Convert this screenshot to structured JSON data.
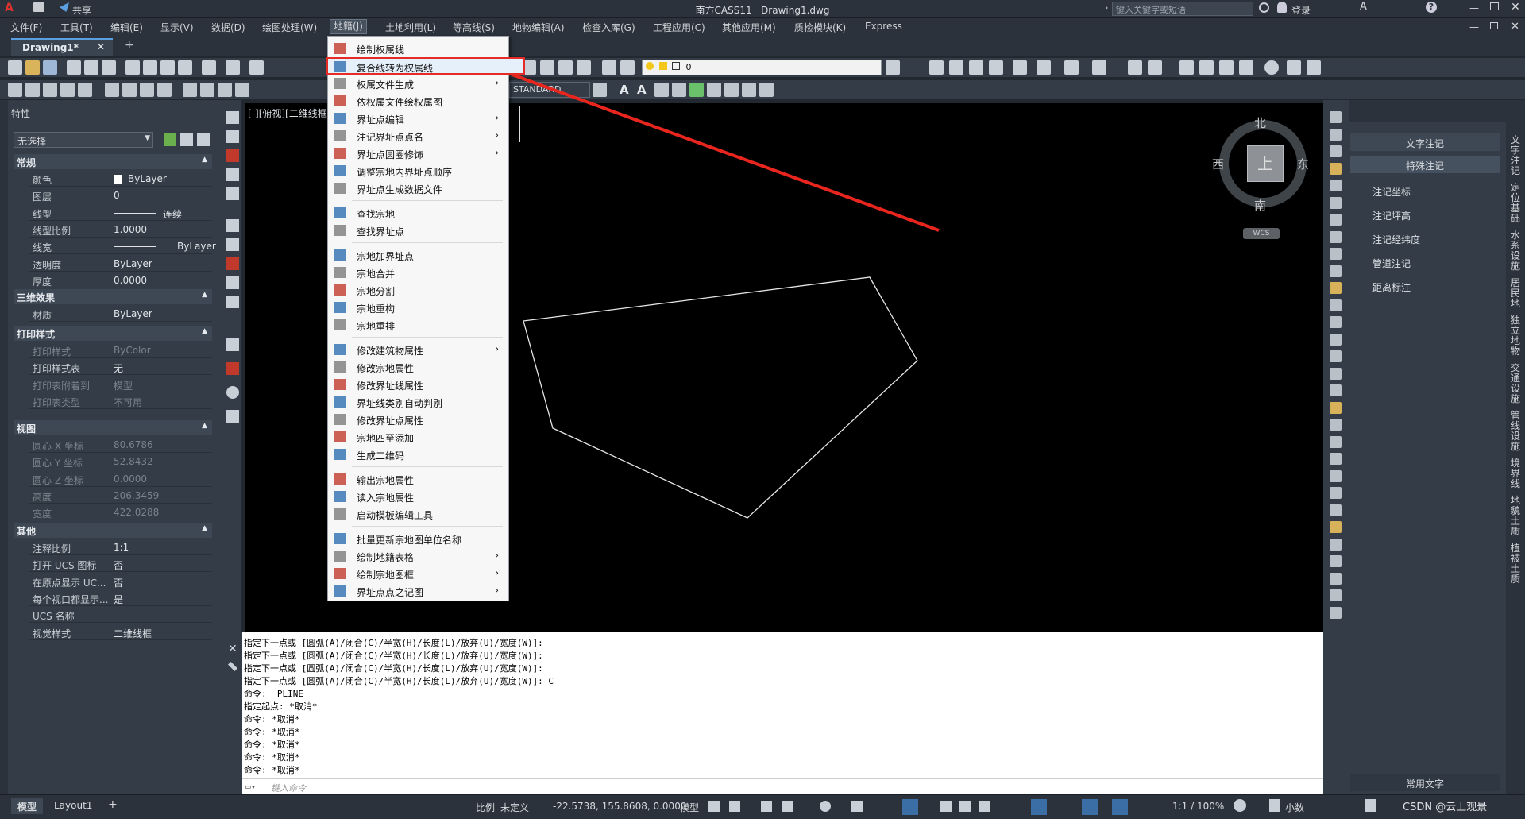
{
  "app": {
    "title": "南方CASS11",
    "filename": "Drawing1.dwg",
    "share_label": "共享",
    "search_placeholder": "键入关键字或短语",
    "login_label": "登录",
    "a_label": "A",
    "tab_label": "Drawing1*",
    "tab_plus": "+"
  },
  "menubar": {
    "items": [
      "文件(F)",
      "工具(T)",
      "编辑(E)",
      "显示(V)",
      "数据(D)",
      "绘图处理(W)",
      "地籍(J)",
      "土地利用(L)",
      "等高线(S)",
      "地物编辑(A)",
      "检查入库(G)",
      "工程应用(C)",
      "其他应用(M)",
      "质检模块(K)",
      "Express"
    ]
  },
  "toolbar": {
    "layer_value": "0",
    "style_value": "STANDARD"
  },
  "properties": {
    "title": "特性",
    "selection": "无选择",
    "sections": {
      "general": "常规",
      "effects3d": "三维效果",
      "plotstyle": "打印样式",
      "view": "视图",
      "other": "其他"
    },
    "general": [
      {
        "k": "颜色",
        "v": "ByLayer"
      },
      {
        "k": "图层",
        "v": "0"
      },
      {
        "k": "线型",
        "v": "连续"
      },
      {
        "k": "线型比例",
        "v": "1.0000"
      },
      {
        "k": "线宽",
        "v": "ByLayer"
      },
      {
        "k": "透明度",
        "v": "ByLayer"
      },
      {
        "k": "厚度",
        "v": "0.0000"
      }
    ],
    "effects3d": [
      {
        "k": "材质",
        "v": "ByLayer"
      }
    ],
    "plotstyle": [
      {
        "k": "打印样式",
        "v": "ByColor"
      },
      {
        "k": "打印样式表",
        "v": "无"
      },
      {
        "k": "打印表附着到",
        "v": "模型"
      },
      {
        "k": "打印表类型",
        "v": "不可用"
      }
    ],
    "view": [
      {
        "k": "圆心 X 坐标",
        "v": "80.6786"
      },
      {
        "k": "圆心 Y 坐标",
        "v": "52.8432"
      },
      {
        "k": "圆心 Z 坐标",
        "v": "0.0000"
      },
      {
        "k": "高度",
        "v": "206.3459"
      },
      {
        "k": "宽度",
        "v": "422.0288"
      }
    ],
    "other": [
      {
        "k": "注释比例",
        "v": "1:1"
      },
      {
        "k": "打开 UCS 图标",
        "v": "否"
      },
      {
        "k": "在原点显示 UC...",
        "v": "否"
      },
      {
        "k": "每个视口都显示...",
        "v": "是"
      },
      {
        "k": "UCS 名称",
        "v": ""
      },
      {
        "k": "视觉样式",
        "v": "二维线框"
      }
    ]
  },
  "viewport": {
    "label": "[-][俯视][二维线框]",
    "compass": {
      "north": "北",
      "south": "南",
      "east": "东",
      "west": "西",
      "top": "上",
      "wcs": "WCS"
    }
  },
  "dropdown": {
    "items": [
      {
        "label": "绘制权属线",
        "arrow": false
      },
      {
        "label": "复合线转为权属线",
        "arrow": false,
        "highlight": true
      },
      {
        "label": "权属文件生成",
        "arrow": true
      },
      {
        "label": "依权属文件绘权属图",
        "arrow": false
      },
      {
        "label": "界址点编辑",
        "arrow": true
      },
      {
        "label": "注记界址点点名",
        "arrow": true
      },
      {
        "label": "界址点圆圈修饰",
        "arrow": true
      },
      {
        "label": "调整宗地内界址点顺序",
        "arrow": false
      },
      {
        "label": "界址点生成数据文件",
        "arrow": false
      },
      {
        "sep": true
      },
      {
        "label": "查找宗地",
        "arrow": false
      },
      {
        "label": "查找界址点",
        "arrow": false
      },
      {
        "sep": true
      },
      {
        "label": "宗地加界址点",
        "arrow": false
      },
      {
        "label": "宗地合并",
        "arrow": false
      },
      {
        "label": "宗地分割",
        "arrow": false
      },
      {
        "label": "宗地重构",
        "arrow": false
      },
      {
        "label": "宗地重排",
        "arrow": false
      },
      {
        "sep": true
      },
      {
        "label": "修改建筑物属性",
        "arrow": true
      },
      {
        "label": "修改宗地属性",
        "arrow": false
      },
      {
        "label": "修改界址线属性",
        "arrow": false
      },
      {
        "label": "界址线类别自动判别",
        "arrow": false
      },
      {
        "label": "修改界址点属性",
        "arrow": false
      },
      {
        "label": "宗地四至添加",
        "arrow": false
      },
      {
        "label": "生成二维码",
        "arrow": false
      },
      {
        "sep": true
      },
      {
        "label": "输出宗地属性",
        "arrow": false
      },
      {
        "label": "读入宗地属性",
        "arrow": false
      },
      {
        "label": "启动模板编辑工具",
        "arrow": false
      },
      {
        "sep": true
      },
      {
        "label": "批量更新宗地图单位名称",
        "arrow": false
      },
      {
        "label": "绘制地籍表格",
        "arrow": true
      },
      {
        "label": "绘制宗地图框",
        "arrow": true
      },
      {
        "label": "界址点点之记图",
        "arrow": true
      }
    ]
  },
  "command": {
    "lines": [
      "指定下一点或 [圆弧(A)/闭合(C)/半宽(H)/长度(L)/放弃(U)/宽度(W)]:",
      "指定下一点或 [圆弧(A)/闭合(C)/半宽(H)/长度(L)/放弃(U)/宽度(W)]:",
      "指定下一点或 [圆弧(A)/闭合(C)/半宽(H)/长度(L)/放弃(U)/宽度(W)]:",
      "指定下一点或 [圆弧(A)/闭合(C)/半宽(H)/长度(L)/放弃(U)/宽度(W)]: C",
      "命令:  PLINE",
      "指定起点: *取消*",
      "命令: *取消*",
      "命令: *取消*",
      "命令: *取消*",
      "命令: *取消*",
      "命令: *取消*"
    ],
    "input_placeholder": "键入命令"
  },
  "right_panel": {
    "tabs": [
      "文字注记",
      "特殊注记"
    ],
    "items": [
      "注记坐标",
      "注记坪高",
      "注记经纬度",
      "管道注记",
      "距离标注"
    ],
    "footer": "常用文字",
    "vtabs": [
      "文字注记",
      "定位基础",
      "水系设施",
      "居民地",
      "独立地物",
      "交通设施",
      "管线设施",
      "境界线",
      "地貌土质",
      "植被土质"
    ]
  },
  "statusbar": {
    "tabs": [
      "模型",
      "Layout1"
    ],
    "plus": "+",
    "scale_label": "比例",
    "scale_value": "未定义",
    "coords": "-22.5738, 155.8608, 0.0000",
    "model": "模型",
    "zoom": "1:1 / 100%",
    "units": "小数",
    "watermark": "CSDN @云上观景"
  },
  "colors": {
    "accent": "#5aa0e0",
    "highlight": "#e52b25",
    "arrow": "#e8261e"
  }
}
